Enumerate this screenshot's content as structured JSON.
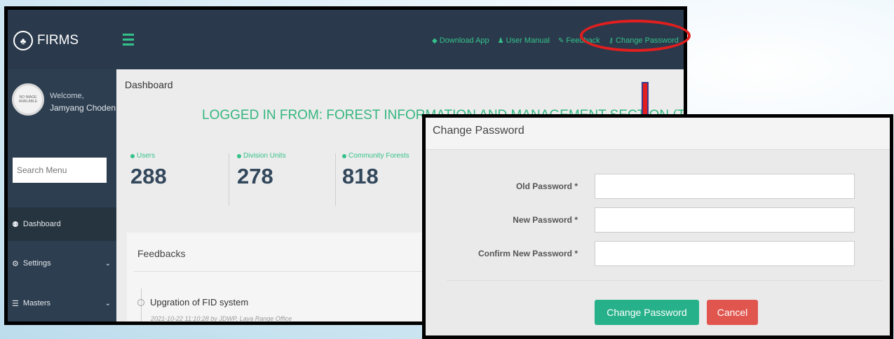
{
  "app": {
    "brand": "FIRMS",
    "nav": [
      {
        "icon": "android-icon",
        "label": "Download App"
      },
      {
        "icon": "person-icon",
        "label": "User Manual"
      },
      {
        "icon": "edit-icon",
        "label": "Feedback"
      },
      {
        "icon": "key-icon",
        "label": "Change Password"
      }
    ],
    "user": {
      "welcome": "Welcome,",
      "name": "Jamyang Choden",
      "avatar_text": "NO IMAGE AVAILABLE"
    },
    "search": {
      "placeholder": "Search Menu"
    },
    "menu": [
      {
        "icon": "dashboard-icon",
        "label": "Dashboard",
        "active": true
      },
      {
        "icon": "settings-icon",
        "label": "Settings",
        "arrow": "⌄"
      },
      {
        "icon": "list-icon",
        "label": "Masters",
        "arrow": "⌄"
      }
    ]
  },
  "dashboard": {
    "title": "Dashboard",
    "logged_in": "LOGGED IN FROM: FOREST INFORMATION AND MANAGEMENT SECTION (Thimphu)",
    "stats": [
      {
        "label": "Users",
        "value": "288"
      },
      {
        "label": "Division Units",
        "value": "278"
      },
      {
        "label": "Community Forests",
        "value": "818"
      }
    ],
    "feedbacks": {
      "title": "Feedbacks",
      "item_title": "Upgration of FID system",
      "item_meta": "2021-10-22 11:10:28 by JDWP, Laya Range Office"
    }
  },
  "modal": {
    "title": "Change Password",
    "fields": [
      {
        "label": "Old Password *",
        "value": ""
      },
      {
        "label": "New Password *",
        "value": ""
      },
      {
        "label": "Confirm New Password *",
        "value": ""
      }
    ],
    "submit_label": "Change Password",
    "cancel_label": "Cancel"
  },
  "colors": {
    "accent": "#35c28a",
    "sidebar": "#2d3e50",
    "highlight": "#e21e1e",
    "primary_btn": "#27b18a",
    "cancel_btn": "#e0564f"
  }
}
